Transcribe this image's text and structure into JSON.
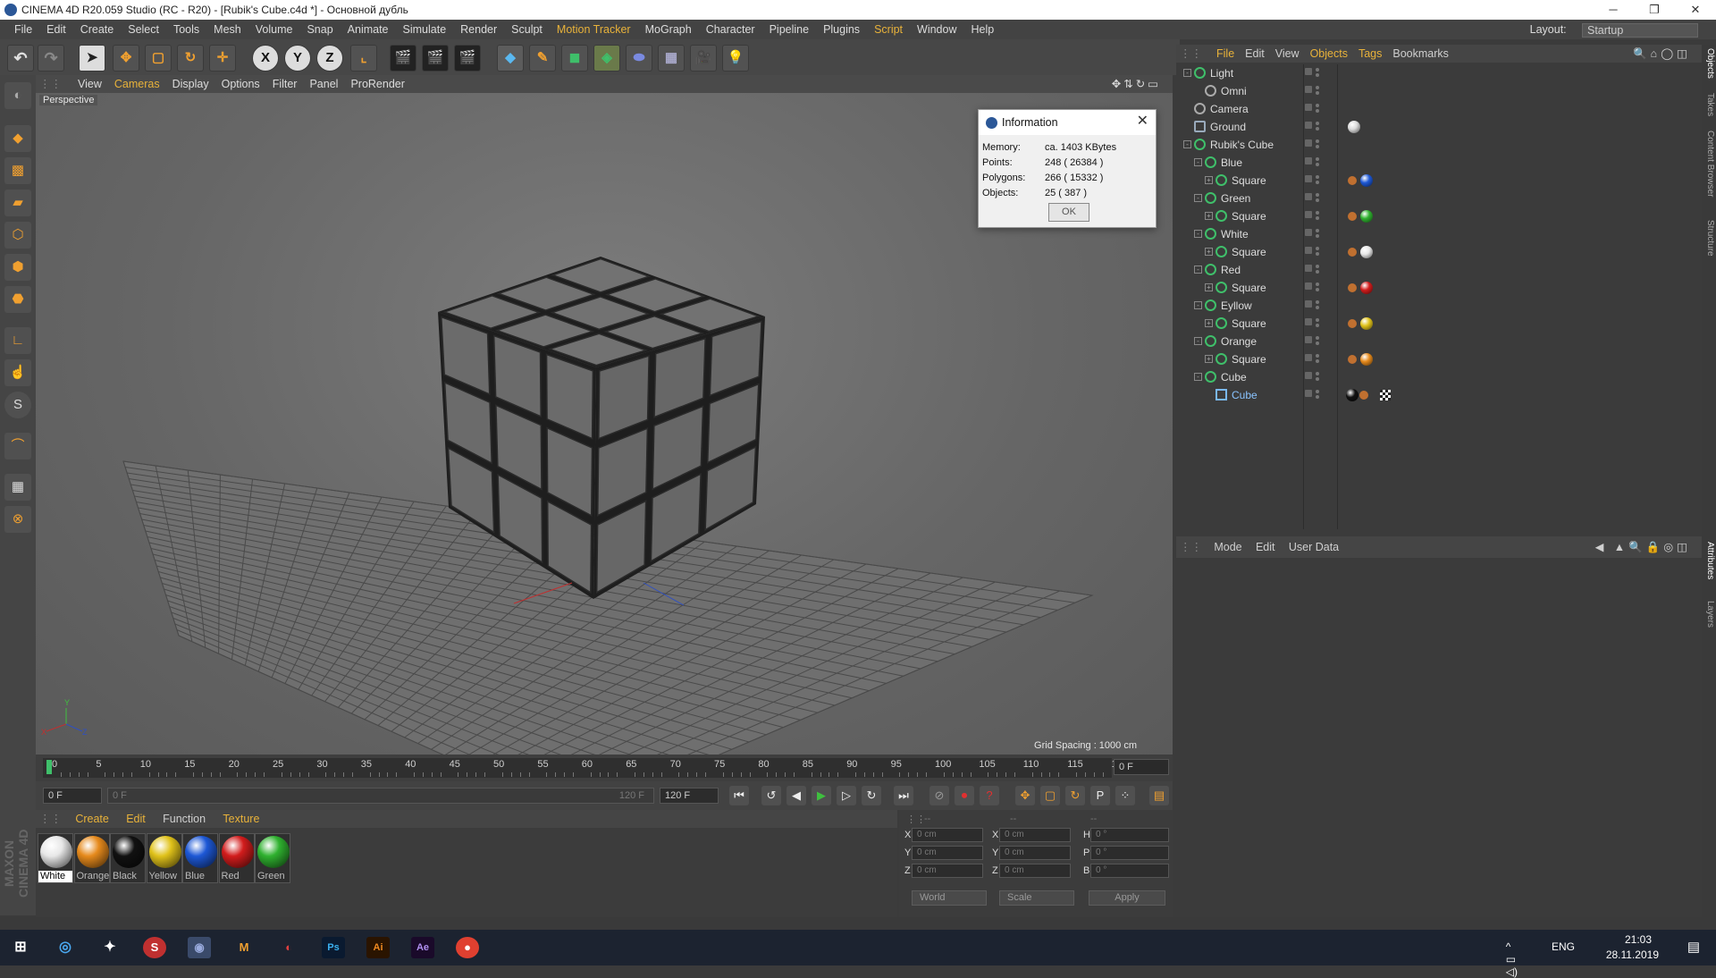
{
  "window": {
    "title": "CINEMA 4D R20.059 Studio (RC - R20) - [Rubik's Cube.c4d *] - Основной дубль",
    "minimize": "─",
    "maximize": "❐",
    "close": "✕"
  },
  "menubar": {
    "items": [
      "File",
      "Edit",
      "Create",
      "Select",
      "Tools",
      "Mesh",
      "Volume",
      "Snap",
      "Animate",
      "Simulate",
      "Render",
      "Sculpt",
      "Motion Tracker",
      "MoGraph",
      "Character",
      "Pipeline",
      "Plugins",
      "Script",
      "Window",
      "Help"
    ],
    "highlighted": [
      "Motion Tracker",
      "Script"
    ],
    "layout_label": "Layout:",
    "layout_value": "Startup"
  },
  "viewport": {
    "menu": [
      "View",
      "Cameras",
      "Display",
      "Options",
      "Filter",
      "Panel",
      "ProRender"
    ],
    "active_menu": "Cameras",
    "label": "Perspective",
    "grid_spacing": "Grid Spacing : 1000 cm",
    "axis": [
      "X",
      "Y",
      "Z"
    ]
  },
  "info_dialog": {
    "title": "Information",
    "rows": [
      {
        "label": "Memory:",
        "value": "ca. 1403 KBytes"
      },
      {
        "label": "Points:",
        "value": "248 ( 26384 )"
      },
      {
        "label": "Polygons:",
        "value": "266 ( 15332 )"
      },
      {
        "label": "Objects:",
        "value": "25 ( 387 )"
      }
    ],
    "ok": "OK"
  },
  "timeline": {
    "ticks": [
      "0",
      "5",
      "10",
      "15",
      "20",
      "25",
      "30",
      "35",
      "40",
      "45",
      "50",
      "55",
      "60",
      "65",
      "70",
      "75",
      "80",
      "85",
      "90",
      "95",
      "100",
      "105",
      "110",
      "115",
      "12("
    ],
    "current_frame": "0 F"
  },
  "transport": {
    "start": "0 F",
    "range_start": "0 F",
    "range_end": "120 F",
    "end": "120 F"
  },
  "materials": {
    "menu": [
      "Create",
      "Edit",
      "Function",
      "Texture"
    ],
    "active_menu": [
      "Create",
      "Edit",
      "Texture"
    ],
    "items": [
      {
        "name": "White",
        "color": "#e8e8e8",
        "selected": true
      },
      {
        "name": "Orange",
        "color": "#e68a1c"
      },
      {
        "name": "Black",
        "color": "#111111"
      },
      {
        "name": "Yellow",
        "color": "#e0c21a"
      },
      {
        "name": "Blue",
        "color": "#1d58d6"
      },
      {
        "name": "Red",
        "color": "#d21c1c"
      },
      {
        "name": "Green",
        "color": "#2fb12f"
      }
    ]
  },
  "coords": {
    "headers": [
      "--",
      "--",
      "--"
    ],
    "rows": [
      {
        "a": "X",
        "b": "X",
        "c": "H",
        "va": "0 cm",
        "vb": "0 cm",
        "vc": "0 °"
      },
      {
        "a": "Y",
        "b": "Y",
        "c": "P",
        "va": "0 cm",
        "vb": "0 cm",
        "vc": "0 °"
      },
      {
        "a": "Z",
        "b": "Z",
        "c": "B",
        "va": "0 cm",
        "vb": "0 cm",
        "vc": "0 °"
      }
    ],
    "mode1": "World",
    "mode2": "Scale",
    "apply": "Apply"
  },
  "objects": {
    "menu": [
      "File",
      "Edit",
      "View",
      "Objects",
      "Tags",
      "Bookmarks"
    ],
    "active_menu": [
      "File",
      "Objects",
      "Tags"
    ],
    "rows": [
      {
        "name": "Light",
        "indent": 0,
        "exp": "-"
      },
      {
        "name": "Omni",
        "indent": 1,
        "exp": ""
      },
      {
        "name": "Camera",
        "indent": 0,
        "exp": ""
      },
      {
        "name": "Ground",
        "indent": 0,
        "exp": "",
        "tag": "#dcdcdc"
      },
      {
        "name": "Rubik's Cube",
        "indent": 0,
        "exp": "-"
      },
      {
        "name": "Blue",
        "indent": 1,
        "exp": "-"
      },
      {
        "name": "Square",
        "indent": 2,
        "exp": "+",
        "tag": "#1d58d6"
      },
      {
        "name": "Green",
        "indent": 1,
        "exp": "-"
      },
      {
        "name": "Square",
        "indent": 2,
        "exp": "+",
        "tag": "#2fb12f"
      },
      {
        "name": "White",
        "indent": 1,
        "exp": "-"
      },
      {
        "name": "Square",
        "indent": 2,
        "exp": "+",
        "tag": "#e8e8e8"
      },
      {
        "name": "Red",
        "indent": 1,
        "exp": "-"
      },
      {
        "name": "Square",
        "indent": 2,
        "exp": "+",
        "tag": "#d21c1c"
      },
      {
        "name": "Eyllow",
        "indent": 1,
        "exp": "-"
      },
      {
        "name": "Square",
        "indent": 2,
        "exp": "+",
        "tag": "#e0c21a"
      },
      {
        "name": "Orange",
        "indent": 1,
        "exp": "-"
      },
      {
        "name": "Square",
        "indent": 2,
        "exp": "+",
        "tag": "#e68a1c"
      },
      {
        "name": "Cube",
        "indent": 1,
        "exp": "-"
      },
      {
        "name": "Cube",
        "indent": 2,
        "exp": "",
        "tag": "#111111",
        "selected": true
      }
    ]
  },
  "attributes": {
    "menu": [
      "Mode",
      "Edit",
      "User Data"
    ]
  },
  "right_tabs": [
    "Objects",
    "Takes",
    "Content Browser",
    "Structure",
    "Attributes",
    "Layers"
  ],
  "taskbar": {
    "lang": "ENG",
    "time": "21:03",
    "date": "28.11.2019",
    "apps": [
      "S",
      "M",
      "Ps",
      "Ai",
      "Ae"
    ]
  },
  "maxon": "MAXON CINEMA 4D"
}
